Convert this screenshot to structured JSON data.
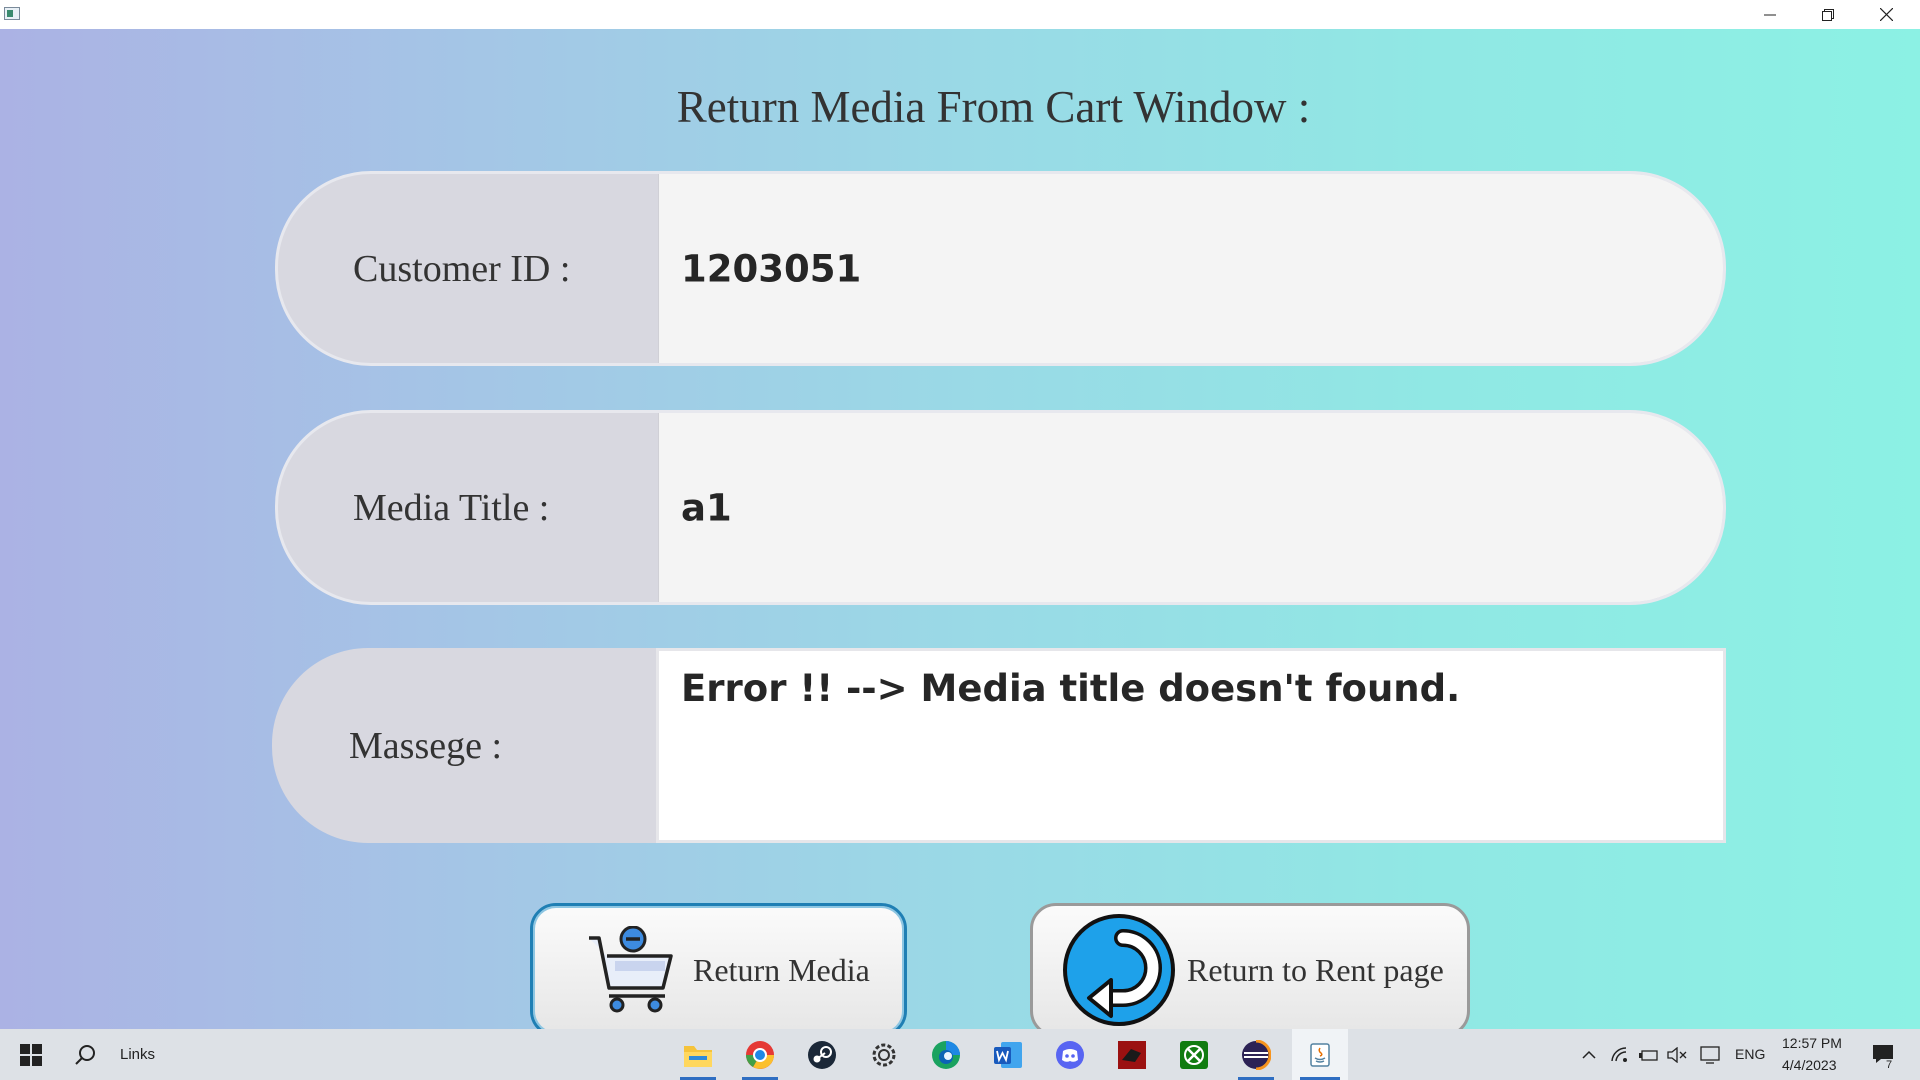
{
  "window": {
    "title": "Return Media From Cart Window :",
    "controls": {
      "minimize": "minimize-icon",
      "restore": "restore-icon",
      "close": "close-icon"
    }
  },
  "form": {
    "customer_id": {
      "label": "Customer ID :",
      "value": "1203051"
    },
    "media_title": {
      "label": "Media Title :",
      "value": "a1"
    },
    "message": {
      "label": "Massege :",
      "value": "Error !! --> Media title doesn't found."
    }
  },
  "buttons": {
    "return_media": {
      "label": "Return Media",
      "icon": "cart-remove-icon"
    },
    "return_rent": {
      "label": "Return to Rent page",
      "icon": "back-arrow-icon"
    }
  },
  "taskbar": {
    "search_label": "Links",
    "apps": [
      "file-explorer-icon",
      "chrome-icon",
      "steam-icon",
      "settings-icon",
      "edge-icon",
      "word-icon",
      "discord-icon",
      "red-app-icon",
      "xbox-icon",
      "eclipse-icon",
      "java-icon"
    ],
    "tray": {
      "language": "ENG",
      "time": "12:57 PM",
      "date": "4/4/2023",
      "notification_count": "7"
    }
  },
  "colors": {
    "gradient_left": "#abb2e4",
    "gradient_right": "#8cf1e4",
    "return_button_border": "#1f7fb4",
    "taskbar_active": "#2f6ec2"
  }
}
